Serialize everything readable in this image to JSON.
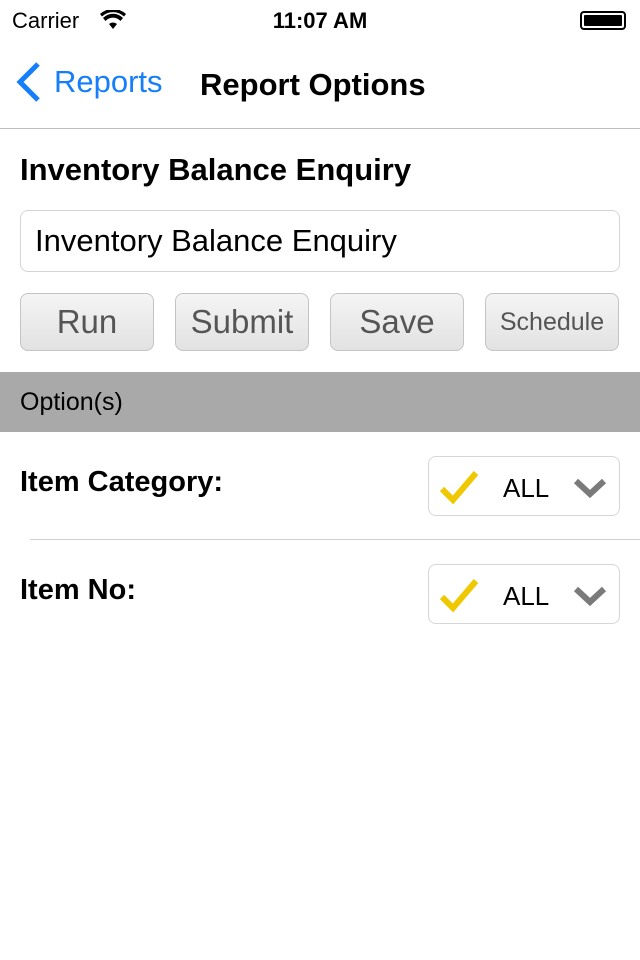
{
  "status_bar": {
    "carrier": "Carrier",
    "time": "11:07 AM"
  },
  "nav": {
    "back_label": "Reports",
    "title": "Report Options"
  },
  "report": {
    "heading": "Inventory Balance Enquiry",
    "name_value": "Inventory Balance Enquiry"
  },
  "buttons": {
    "run": "Run",
    "submit": "Submit",
    "save": "Save",
    "schedule": "Schedule"
  },
  "section": {
    "title": "Option(s)"
  },
  "options": [
    {
      "label": "Item Category:",
      "value": "ALL"
    },
    {
      "label": "Item No:",
      "value": "ALL"
    }
  ],
  "colors": {
    "accent": "#157efb",
    "check": "#f0c800",
    "section_bg": "#a9a9a9"
  }
}
